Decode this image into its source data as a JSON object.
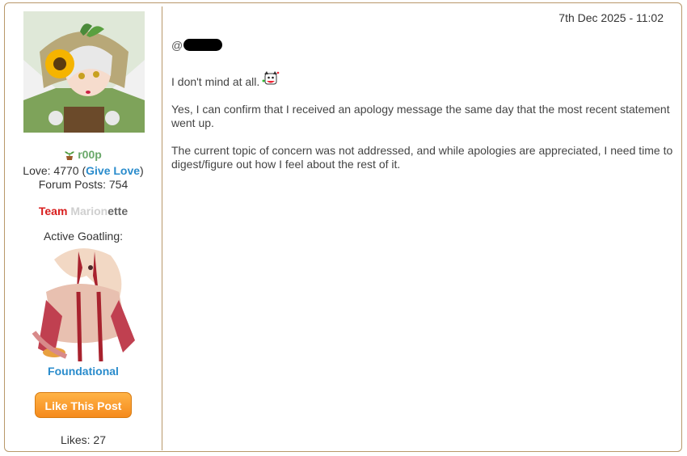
{
  "user": {
    "name": "r00p",
    "love_prefix": "Love: 4770 (",
    "give_love": "Give Love",
    "love_suffix": ")",
    "forum_posts": "Forum Posts: 754",
    "team_part1": "Team ",
    "team_part2": "Marion",
    "team_part3": "ette",
    "active_goatling_label": "Active Goatling:",
    "goatling_name": "Foundational",
    "like_button": "Like This Post",
    "likes": "Likes: 27"
  },
  "post": {
    "date": "7th Dec 2025 - 11:02",
    "mention_at": "@",
    "paragraph1": "I don't mind at all.",
    "paragraph2": "Yes, I can confirm that I received an apology message the same day that the most recent statement went up.",
    "paragraph3": "The current topic of concern was not addressed, and while apologies are appreciated, I need time to digest/figure out how I feel about the rest of it."
  },
  "colors": {
    "border": "#b8986a",
    "username": "#6aa86a",
    "link_blue": "#2a8ccc",
    "team_red": "#d81e1e",
    "like_orange": "#f58a1c"
  },
  "icons": [
    "plant-icon",
    "avatar-image",
    "goatling-image",
    "emote-icon"
  ]
}
